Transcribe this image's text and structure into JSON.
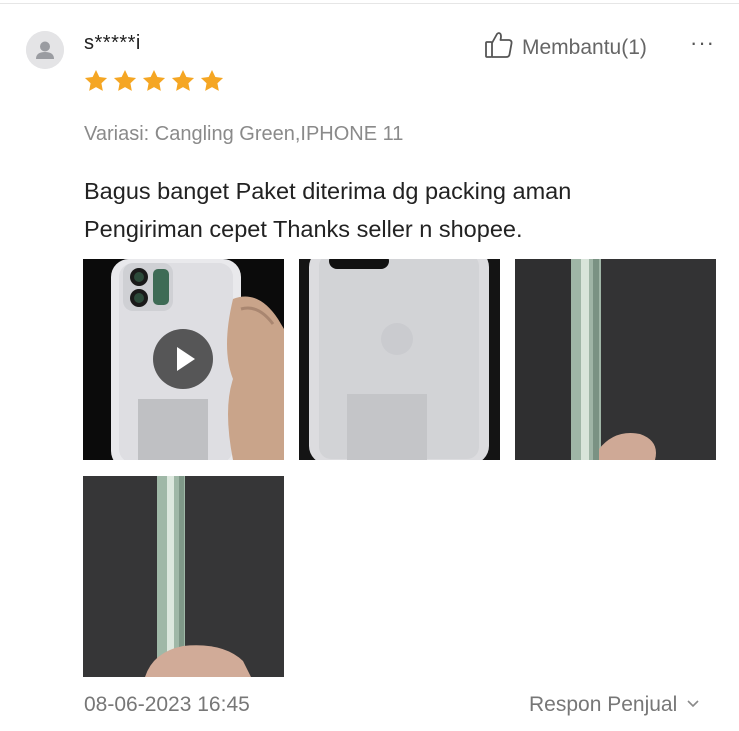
{
  "review": {
    "username": "s*****i",
    "rating": 5,
    "helpful_label": "Membantu(1)",
    "more_label": "···",
    "variation": "Variasi: Cangling Green,IPHONE 11",
    "comment_lines": [
      "Bagus banget Paket diterima dg packing aman",
      "Pengiriman cepet  Thanks seller n shopee."
    ],
    "media": [
      {
        "kind": "video",
        "icon": "play-icon"
      },
      {
        "kind": "image"
      },
      {
        "kind": "image"
      },
      {
        "kind": "image"
      }
    ],
    "datetime": "08-06-2023 16:45",
    "seller_response_label": "Respon Penjual"
  },
  "colors": {
    "star": "#f5a623",
    "muted_text": "#8a8a8a",
    "avatar_bg": "#e4e4e6"
  },
  "icons": [
    "user-avatar-icon",
    "thumbs-up-icon",
    "more-icon",
    "star-icon",
    "play-icon",
    "chevron-down-icon"
  ]
}
